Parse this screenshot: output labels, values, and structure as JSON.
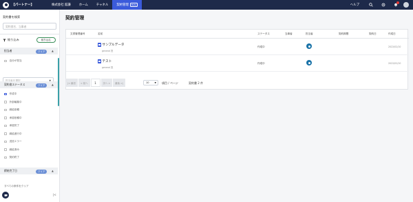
{
  "nav": {
    "partner": "【パートナー】",
    "items": [
      "株式会社 館謙",
      "ホーム",
      "チャネル",
      "契約管理"
    ],
    "active_index": 3,
    "beta": "Beta",
    "help": "ヘルプ"
  },
  "sidebar": {
    "search_label": "契約書を検索",
    "search_placeholder": "契約書名、当事者",
    "filter_label": "絞り込み",
    "filter_button": "絞り込む",
    "sections": {
      "favorite": {
        "title": "担当者",
        "clear": "クリア",
        "checkbox": "自分が担当"
      },
      "select_placeholder": "担当者を選択",
      "status": {
        "title": "契約書ステータス",
        "clear": "クリア",
        "options": [
          "作成中",
          "外部編集中",
          "締結依頼",
          "承認依頼中",
          "承認完了",
          "締結進行中",
          "送信エラー",
          "締結済み",
          "契約終了"
        ],
        "checked": [
          true,
          false,
          false,
          false,
          false,
          false,
          false,
          false,
          false
        ]
      },
      "date": {
        "title": "締結完了日",
        "clear": "クリア"
      }
    },
    "clear_all": "すべての条件をクリア",
    "collapse": "|<"
  },
  "main": {
    "title": "契約管理",
    "columns": [
      "文書管理番号",
      "名前",
      "ステータス",
      "当事者",
      "担当者",
      "契約期間",
      "契約日",
      "作成日"
    ],
    "rows": [
      {
        "name": "サンプルデータ",
        "sub": "general  担",
        "status": "作成中",
        "date": "2022/02/10"
      },
      {
        "name": "テスト",
        "sub": "general  担",
        "status": "作成中",
        "date": "2022/02/10"
      }
    ],
    "pager": {
      "first": "|< 最初",
      "prev": "< 前へ",
      "current": "1",
      "next": "次へ >",
      "last": "最後 >|"
    },
    "per_page_value": "10",
    "per_page_label": "項目 / ページ",
    "count_label": "契約書 2 件"
  },
  "colors": {
    "nav_bg": "#1e2a4a",
    "active": "#3b5bdb",
    "accent": "#3aa0a8"
  }
}
